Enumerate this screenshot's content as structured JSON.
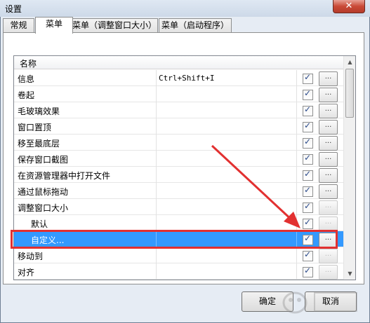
{
  "window": {
    "title": "设置",
    "close_glyph": "✕"
  },
  "tabs": [
    {
      "label": "常规",
      "active": false
    },
    {
      "label": "菜单",
      "active": true
    },
    {
      "label": "菜单（调整窗口大小）",
      "active": false
    },
    {
      "label": "菜单（启动程序）",
      "active": false
    }
  ],
  "list": {
    "column_header": "名称",
    "rows": [
      {
        "name": "信息",
        "hotkey": "Ctrl+Shift+I",
        "checked": true,
        "button": "...",
        "indent": false,
        "selected": false,
        "button_enabled": true
      },
      {
        "name": "卷起",
        "hotkey": "",
        "checked": true,
        "button": "...",
        "indent": false,
        "selected": false,
        "button_enabled": true
      },
      {
        "name": "毛玻璃效果",
        "hotkey": "",
        "checked": true,
        "button": "...",
        "indent": false,
        "selected": false,
        "button_enabled": true
      },
      {
        "name": "窗口置顶",
        "hotkey": "",
        "checked": true,
        "button": "...",
        "indent": false,
        "selected": false,
        "button_enabled": true
      },
      {
        "name": "移至最底层",
        "hotkey": "",
        "checked": true,
        "button": "...",
        "indent": false,
        "selected": false,
        "button_enabled": true
      },
      {
        "name": "保存窗口截图",
        "hotkey": "",
        "checked": true,
        "button": "...",
        "indent": false,
        "selected": false,
        "button_enabled": true
      },
      {
        "name": "在资源管理器中打开文件",
        "hotkey": "",
        "checked": true,
        "button": "...",
        "indent": false,
        "selected": false,
        "button_enabled": true
      },
      {
        "name": "通过鼠标拖动",
        "hotkey": "",
        "checked": true,
        "button": "...",
        "indent": false,
        "selected": false,
        "button_enabled": true
      },
      {
        "name": "调整窗口大小",
        "hotkey": "",
        "checked": true,
        "button": "...",
        "indent": false,
        "selected": false,
        "button_enabled": false
      },
      {
        "name": "默认",
        "hotkey": "",
        "checked": true,
        "button": "...",
        "indent": true,
        "selected": false,
        "button_enabled": false
      },
      {
        "name": "自定义...",
        "hotkey": "",
        "checked": true,
        "button": "...",
        "indent": true,
        "selected": true,
        "button_enabled": true
      },
      {
        "name": "移动到",
        "hotkey": "",
        "checked": true,
        "button": "...",
        "indent": false,
        "selected": false,
        "button_enabled": false
      },
      {
        "name": "对齐",
        "hotkey": "",
        "checked": true,
        "button": "...",
        "indent": false,
        "selected": false,
        "button_enabled": false
      }
    ]
  },
  "buttons": {
    "ok": "确定",
    "cancel": "取消"
  },
  "colors": {
    "selection": "#3399ff",
    "highlight_annotation": "#e23030"
  },
  "icons": {
    "checkbox_tick": "✓",
    "scroll_up": "▲",
    "scroll_down": "▼"
  }
}
